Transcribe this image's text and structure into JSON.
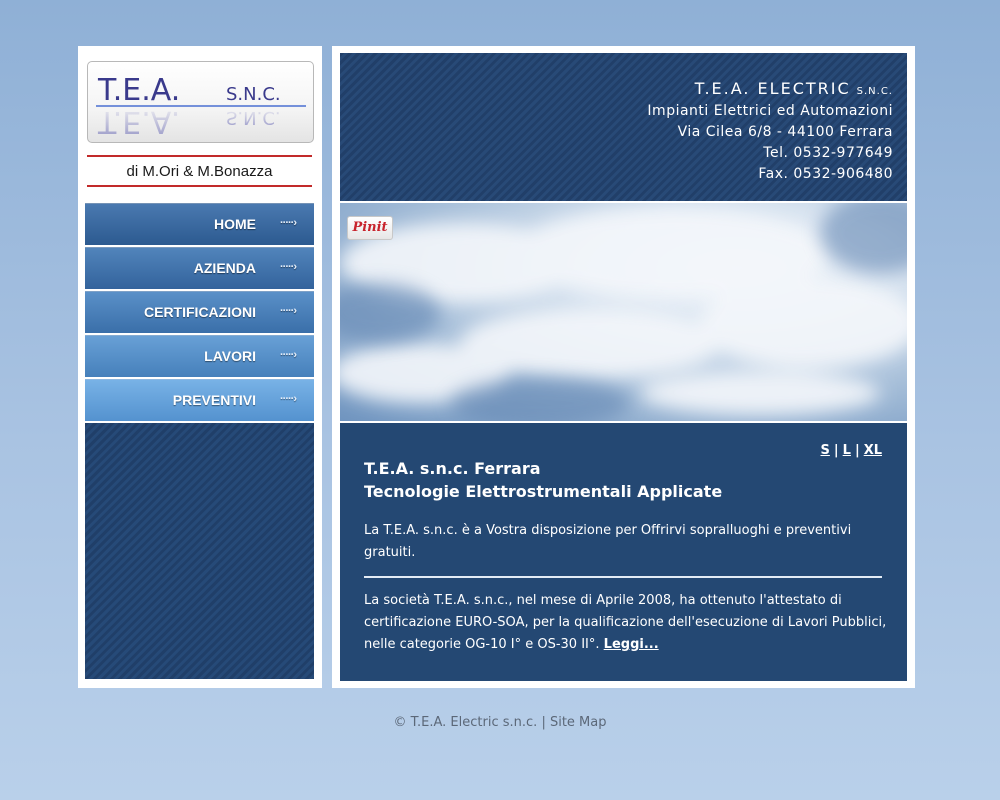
{
  "sidebar": {
    "logo": {
      "text": "T.E.A.",
      "suffix": "S.N.C.",
      "colors": {
        "primary": "#3a3a8c",
        "accent": "#4a6fd1"
      }
    },
    "owners": "di M.Ori & M.Bonazza",
    "nav": [
      {
        "label": "HOME"
      },
      {
        "label": "AZIENDA"
      },
      {
        "label": "CERTIFICAZIONI"
      },
      {
        "label": "LAVORI"
      },
      {
        "label": "PREVENTIVI"
      }
    ],
    "arrow_glyph": "·····›"
  },
  "header": {
    "company": "T.E.A. ELECTRIC",
    "company_suffix": "S.N.C.",
    "lines": [
      "Impianti Elettrici ed Automazioni",
      "Via Cilea 6/8 - 44100 Ferrara",
      "Tel. 0532-977649",
      "Fax. 0532-906480"
    ]
  },
  "pinit": "Pinit",
  "content": {
    "sizes": [
      "S",
      "L",
      "XL"
    ],
    "separator": "|",
    "title1": "T.E.A. s.n.c. Ferrara",
    "title2": "Tecnologie Elettrostrumentali Applicate",
    "para1": "La T.E.A. s.n.c. è a Vostra disposizione per Offrirvi sopralluoghi e preventivi gratuiti.",
    "para2": "La società T.E.A. s.n.c., nel mese di Aprile 2008, ha ottenuto l'attestato di certificazione EURO-SOA, per la qualificazione dell'esecuzione di Lavori Pubblici, nelle categorie OG-10 I° e OS-30 II°.",
    "read_more": "Leggi..."
  },
  "footer": {
    "copyright": "© T.E.A. Electric s.n.c.",
    "separator": "|",
    "sitemap": "Site Map"
  },
  "colors": {
    "page_bg": "#a9c3e2",
    "dark_blue": "#244873",
    "red_rule": "#c22a2a"
  }
}
